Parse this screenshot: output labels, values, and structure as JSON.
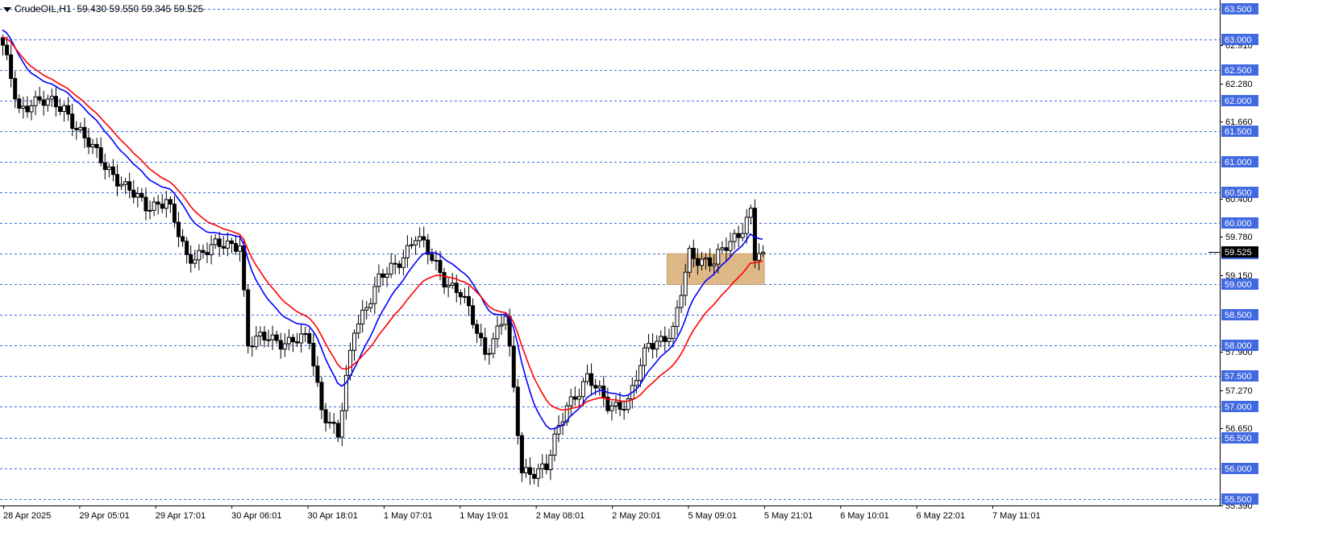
{
  "header": {
    "symbol_timeframe": "CrudeOIL,H1",
    "ohlc": "59.430 59.550 59.345 59.525"
  },
  "colors": {
    "ema_fast": "#0000ff",
    "ema_slow": "#ff0000",
    "grid": "#4169e1",
    "zone_fill": "#deb887",
    "label_bg": "#4169e1",
    "current_price_bg": "#000000"
  },
  "chart_data": {
    "type": "candlestick",
    "title": "",
    "xlabel": "",
    "ylabel": "",
    "ylim": [
      55.39,
      63.59
    ],
    "grid": true,
    "x_tick_labels": [
      "28 Apr 2025",
      "29 Apr 05:01",
      "29 Apr 17:01",
      "30 Apr 06:01",
      "30 Apr 18:01",
      "1 May 07:01",
      "1 May 19:01",
      "2 May 08:01",
      "2 May 20:01",
      "5 May 09:01",
      "5 May 21:01",
      "6 May 10:01",
      "6 May 22:01",
      "7 May 11:01"
    ],
    "level_labels": [
      "63.500",
      "63.000",
      "62.500",
      "62.000",
      "61.500",
      "61.000",
      "60.500",
      "60.000",
      "59.500",
      "59.000",
      "58.500",
      "58.000",
      "57.500",
      "57.000",
      "56.500",
      "56.000",
      "55.500"
    ],
    "level_values": [
      63.5,
      63.0,
      62.5,
      62.0,
      61.5,
      61.0,
      60.5,
      60.0,
      59.5,
      59.0,
      58.5,
      58.0,
      57.5,
      57.0,
      56.5,
      56.0,
      55.5
    ],
    "scale_labels": [
      "62.910",
      "62.280",
      "61.660",
      "60.400",
      "59.780",
      "59.150",
      "57.900",
      "57.270",
      "56.650",
      "55.390"
    ],
    "scale_values": [
      62.91,
      62.28,
      61.66,
      60.4,
      59.78,
      59.15,
      57.9,
      57.27,
      56.65,
      55.39
    ],
    "current_price_label": "59.525",
    "current_price": 59.525,
    "zone": {
      "y_low": 59.0,
      "y_high": 59.5,
      "from_bar": 163,
      "to_bar": 186
    },
    "bars_count": 183,
    "series": [
      {
        "type": "candles",
        "keypoints": [
          [
            0,
            62.85
          ],
          [
            4,
            61.85
          ],
          [
            7,
            62.0
          ],
          [
            15,
            61.9
          ],
          [
            20,
            61.35
          ],
          [
            26,
            60.9
          ],
          [
            30,
            60.55
          ],
          [
            35,
            60.3
          ],
          [
            40,
            60.35
          ],
          [
            45,
            59.45
          ],
          [
            52,
            59.6
          ],
          [
            58,
            59.7
          ],
          [
            60,
            58.0
          ],
          [
            65,
            58.15
          ],
          [
            70,
            58.05
          ],
          [
            75,
            58.1
          ],
          [
            78,
            57.0
          ],
          [
            82,
            56.5
          ],
          [
            86,
            58.3
          ],
          [
            92,
            59.05
          ],
          [
            96,
            59.3
          ],
          [
            101,
            59.8
          ],
          [
            108,
            59.1
          ],
          [
            112,
            58.85
          ],
          [
            118,
            57.9
          ],
          [
            123,
            58.5
          ],
          [
            127,
            55.95
          ],
          [
            133,
            56.0
          ],
          [
            138,
            57.05
          ],
          [
            143,
            57.45
          ],
          [
            148,
            57.05
          ],
          [
            153,
            57.05
          ],
          [
            158,
            58.05
          ],
          [
            164,
            58.2
          ],
          [
            168,
            59.5
          ],
          [
            174,
            59.35
          ],
          [
            180,
            59.85
          ],
          [
            183,
            60.2
          ],
          [
            184,
            59.45
          ],
          [
            186,
            59.525
          ]
        ]
      }
    ]
  }
}
